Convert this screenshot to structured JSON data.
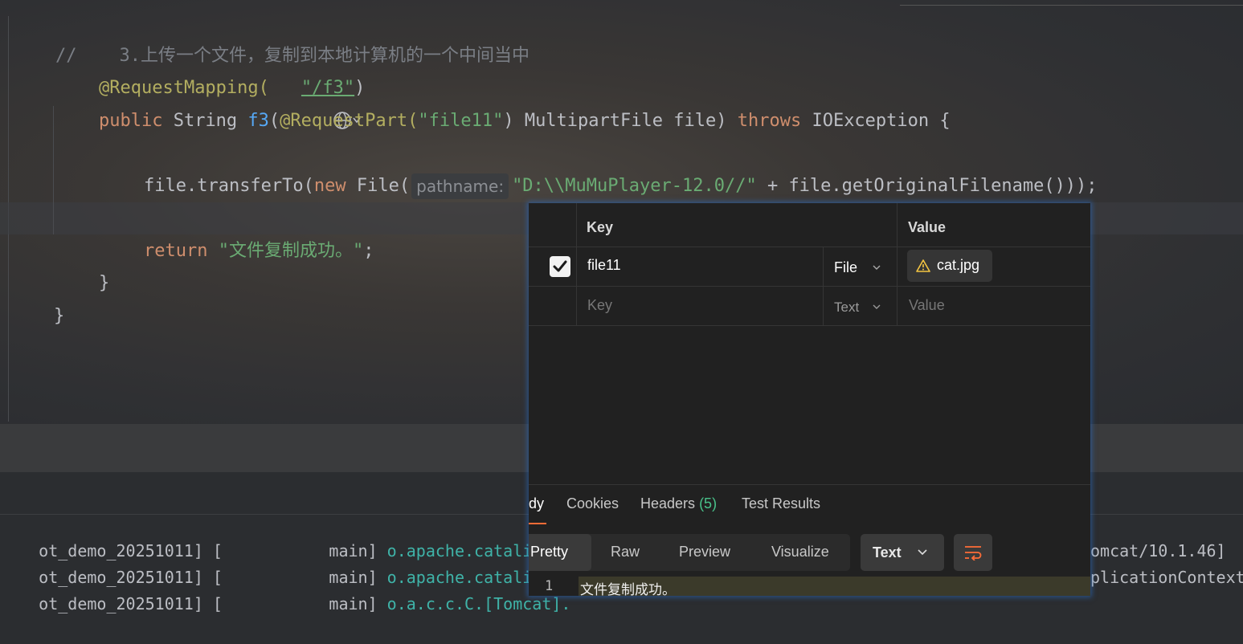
{
  "editor": {
    "comment_line": "//    3.上传一个文件，复制到本地计算机的一个中间当中",
    "annotation": "@RequestMapping(",
    "annotation_arg": "\"/f3\"",
    "annotation_close": ")",
    "sig_public": "public ",
    "sig_type": "String ",
    "sig_name": "f3",
    "sig_paren": "(",
    "sig_param_ann": "@RequestPart(",
    "sig_param_str": "\"file11\"",
    "sig_param_rest": ") MultipartFile file) ",
    "sig_throws": "throws ",
    "sig_exc": "IOException {",
    "stmt_call": "file.transferTo(",
    "stmt_new": "new ",
    "stmt_file": "File(",
    "param_hint": "pathname:",
    "stmt_str": "\"D:\\\\MuMuPlayer-12.0//\"",
    "stmt_rest": " + file.getOriginalFilename()));",
    "return_kw": "return ",
    "return_str": "\"文件复制成功。\"",
    "return_semi": ";",
    "close_method": "}",
    "close_class": "}"
  },
  "console": {
    "lines": [
      {
        "prefix": "ot_demo_20251011] [           main] ",
        "cls": "o.apache.catalina.c",
        "right": ""
      },
      {
        "prefix": "ot_demo_20251011] [           main] ",
        "cls": "o.apache.catalina.c",
        "right": "omcat/10.1.46]"
      },
      {
        "prefix": "ot_demo_20251011] [           main] ",
        "cls": "o.a.c.c.C.[Tomcat].",
        "right": "plicationContext"
      }
    ]
  },
  "postman": {
    "table": {
      "col_key": "Key",
      "col_value": "Value",
      "row1": {
        "key": "file11",
        "type": "File",
        "value": "cat.jpg"
      },
      "row2": {
        "key_placeholder": "Key",
        "type": "Text",
        "value_placeholder": "Value"
      }
    },
    "tabs": {
      "body": "dy",
      "cookies": "Cookies",
      "headers": "Headers",
      "headers_count": "(5)",
      "tests": "Test Results"
    },
    "view_modes": {
      "pretty": "Pretty",
      "raw": "Raw",
      "preview": "Preview",
      "visualize": "Visualize"
    },
    "format_select": "Text",
    "response": {
      "line_no": "1",
      "text": "文件复制成功。"
    }
  },
  "colors": {
    "accent": "#ff6c37",
    "headers_count": "#49c18a",
    "warning": "#f4c542"
  }
}
